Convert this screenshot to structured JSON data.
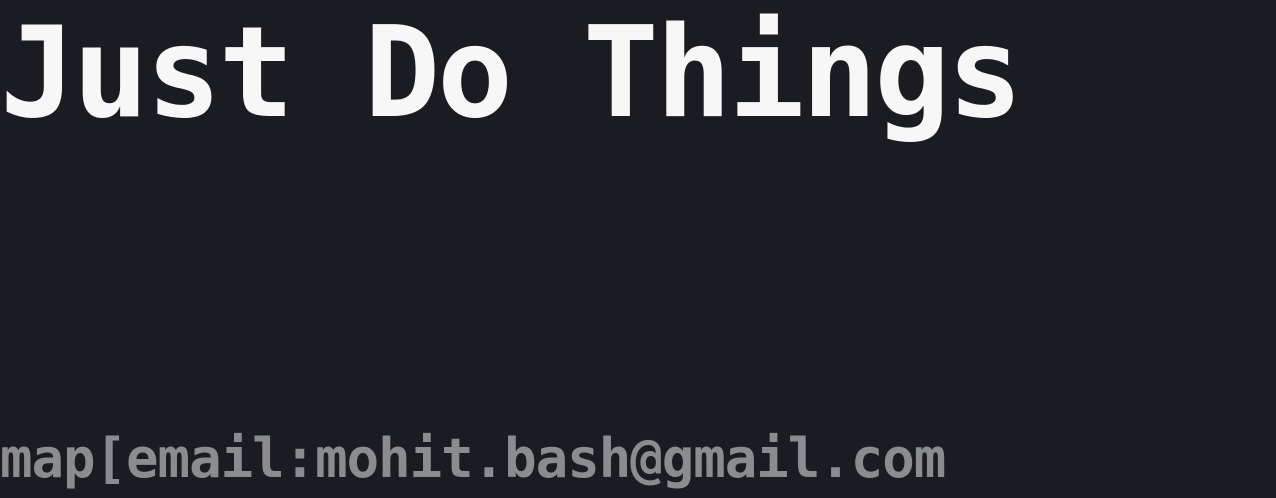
{
  "title": "Just Do Things",
  "footer": {
    "text": "map[email:mohit.bash@gmail.com"
  },
  "colors": {
    "background": "#1b1c21",
    "title": "#f7f7f7",
    "footer": "#8b8c90"
  }
}
